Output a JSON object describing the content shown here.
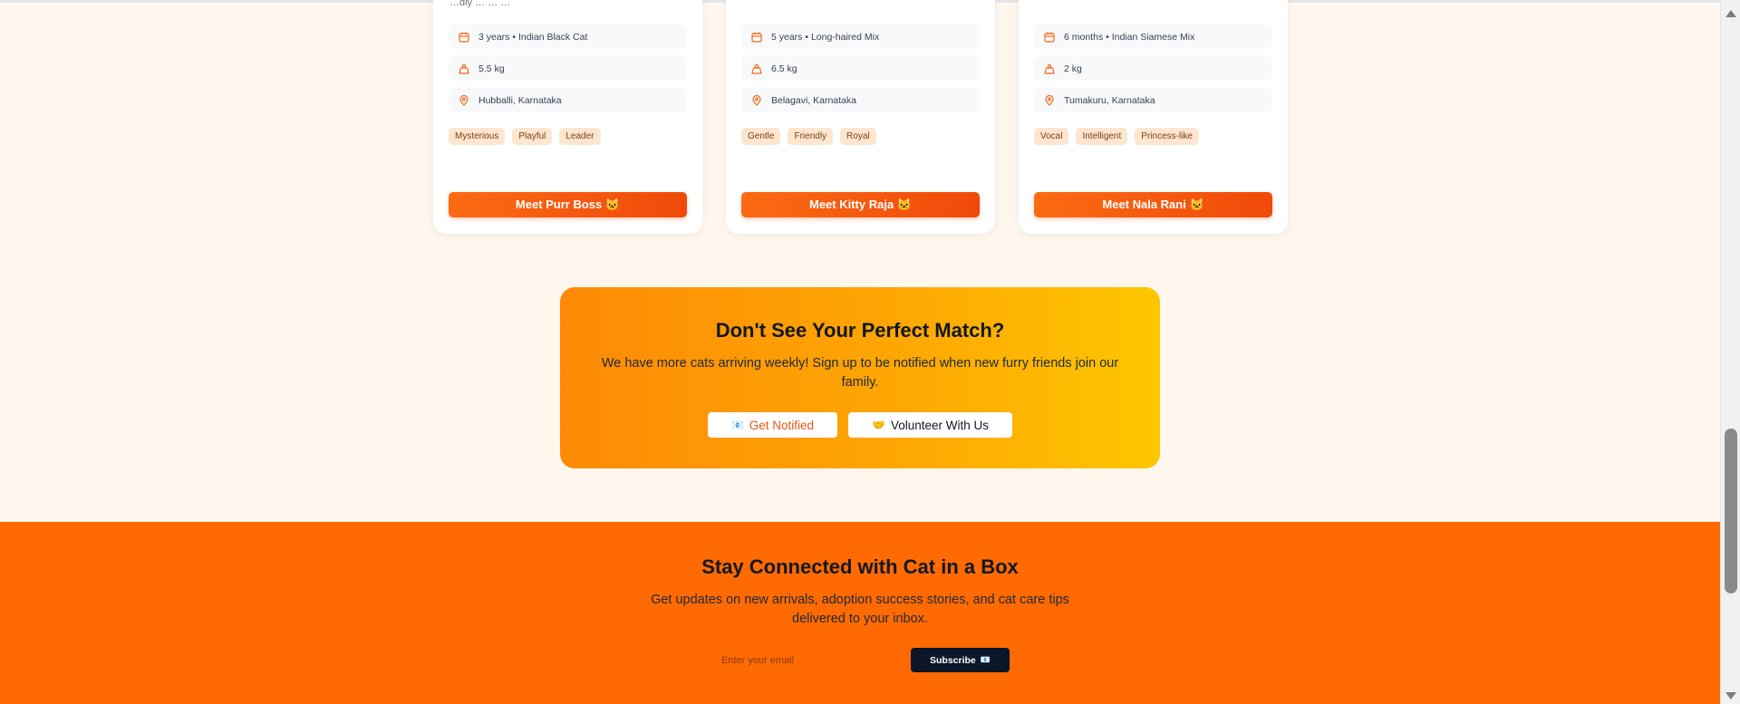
{
  "cards": [
    {
      "subtitle": "…dly … … …",
      "age_breed": "3 years • Indian Black Cat",
      "weight": "5.5 kg",
      "location": "Hubballi, Karnataka",
      "tags": [
        "Mysterious",
        "Playful",
        "Leader"
      ],
      "button": "Meet Purr Boss 🐱"
    },
    {
      "subtitle": "",
      "age_breed": "5 years • Long-haired Mix",
      "weight": "6.5 kg",
      "location": "Belagavi, Karnataka",
      "tags": [
        "Gentle",
        "Friendly",
        "Royal"
      ],
      "button": "Meet Kitty Raja 🐱"
    },
    {
      "subtitle": "",
      "age_breed": "6 months • Indian Siamese Mix",
      "weight": "2 kg",
      "location": "Tumakuru, Karnataka",
      "tags": [
        "Vocal",
        "Intelligent",
        "Princess-like"
      ],
      "button": "Meet Nala Rani 🐱"
    }
  ],
  "cta": {
    "title": "Don't See Your Perfect Match?",
    "text": "We have more cats arriving weekly! Sign up to be notified when new furry friends join our family.",
    "notify_icon": "📧",
    "notify_label": "Get Notified",
    "volunteer_icon": "🤝",
    "volunteer_label": "Volunteer With Us"
  },
  "footer": {
    "title": "Stay Connected with Cat in a Box",
    "text": "Get updates on new arrivals, adoption success stories, and cat care tips delivered to your inbox.",
    "email_placeholder": "Enter your email",
    "subscribe_label": "Subscribe",
    "subscribe_icon": "📧"
  },
  "colors": {
    "accent": "#fb6a13",
    "footer_bg": "#ff6a03",
    "cta_gradient_start": "#fd8a06",
    "cta_gradient_end": "#fdc600",
    "subscribe_bg": "#0b1629",
    "tag_bg": "#fde6cf"
  }
}
